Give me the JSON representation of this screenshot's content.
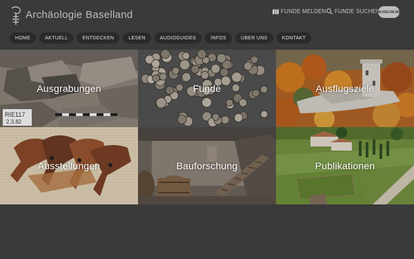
{
  "site": {
    "title": "Archäologie Baselland"
  },
  "utility": {
    "funde_melden": "FUNDE MELDEN",
    "funde_suchen": "FUNDE SUCHEN",
    "badge": "MUSEUM.BL"
  },
  "nav": [
    "HOME",
    "AKTUELL",
    "ENTDECKEN",
    "LESEN",
    "AUDIOGUIDES",
    "INFOS",
    "ÜBER UNS",
    "KONTAKT"
  ],
  "tiles": [
    {
      "label": "Ausgrabungen",
      "sign_line1": "RIE117",
      "sign_line2": "2.3.82"
    },
    {
      "label": "Funde"
    },
    {
      "label": "Ausflugsziele"
    },
    {
      "label": "Ausstellungen"
    },
    {
      "label": "Bauforschung"
    },
    {
      "label": "Publikationen"
    }
  ]
}
